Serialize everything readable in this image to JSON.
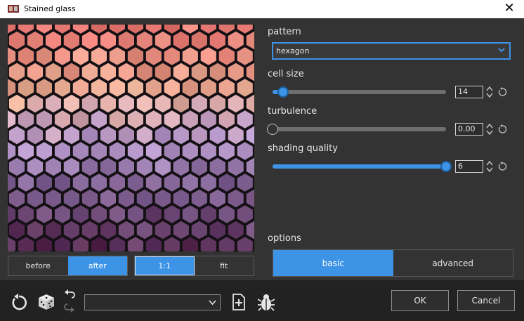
{
  "window": {
    "title": "Stained glass"
  },
  "preview": {
    "view_toggle": [
      {
        "label": "before",
        "active": false
      },
      {
        "label": "after",
        "active": true
      }
    ],
    "zoom_toggle": [
      {
        "label": "1:1",
        "active": true
      },
      {
        "label": "fit",
        "active": false
      }
    ]
  },
  "pattern": {
    "label": "pattern",
    "value": "hexagon"
  },
  "cell_size": {
    "label": "cell size",
    "value": "14",
    "fraction": 0.06
  },
  "turbulence": {
    "label": "turbulence",
    "value": "0.00",
    "fraction": 0.0
  },
  "shading_quality": {
    "label": "shading quality",
    "value": "6",
    "fraction": 1.0
  },
  "options": {
    "label": "options",
    "tabs": [
      {
        "label": "basic",
        "active": true
      },
      {
        "label": "advanced",
        "active": false
      }
    ]
  },
  "footer": {
    "ok_label": "OK",
    "cancel_label": "Cancel"
  },
  "colors": {
    "accent": "#3d93e6",
    "background": "#333333",
    "footer": "#222222"
  },
  "icons": [
    "reset-icon",
    "dice-icon",
    "undo-icon",
    "redo-icon",
    "add-preset-icon",
    "bug-icon"
  ]
}
